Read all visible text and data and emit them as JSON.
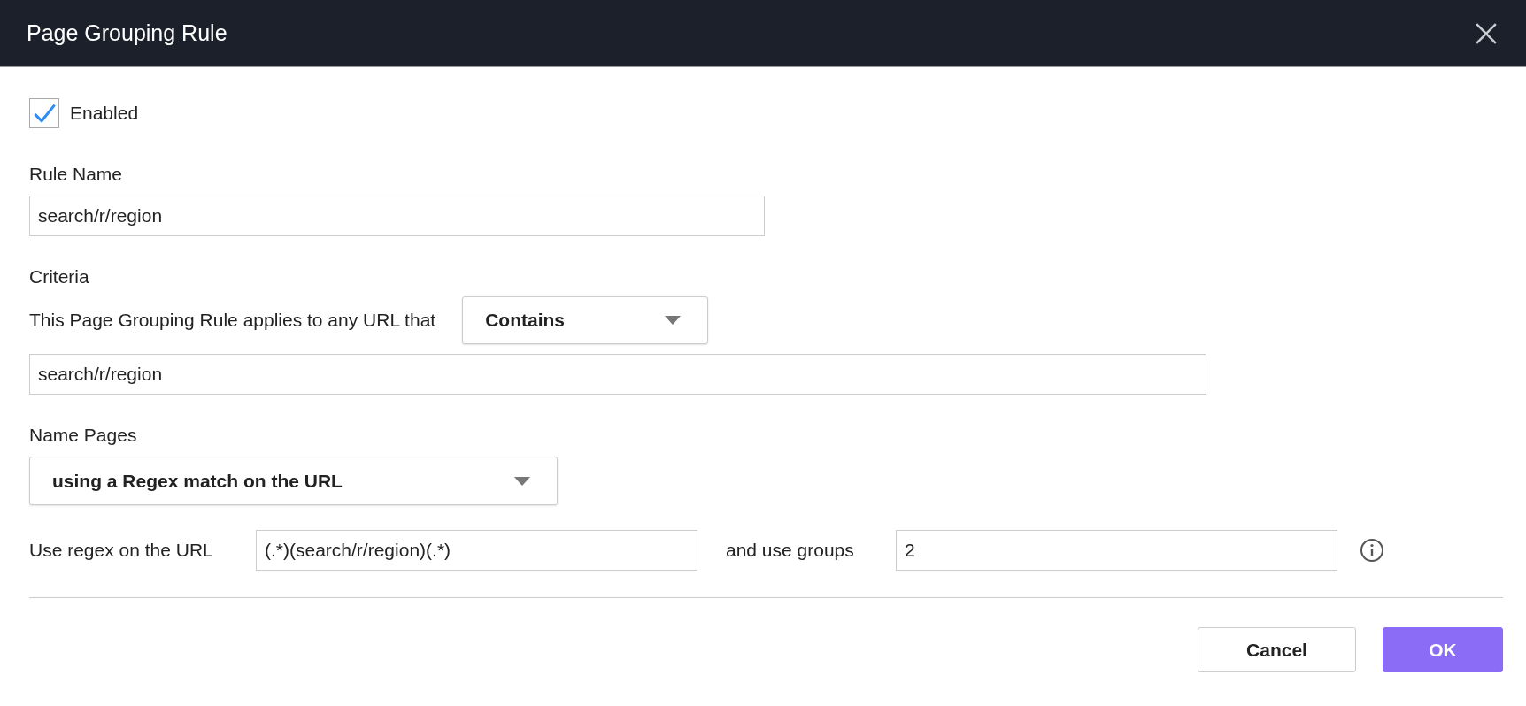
{
  "window": {
    "title": "Page Grouping Rule"
  },
  "enabled": {
    "label": "Enabled",
    "checked": true
  },
  "rule_name": {
    "label": "Rule Name",
    "value": "search/r/region"
  },
  "criteria": {
    "label": "Criteria",
    "sentence": "This Page Grouping Rule applies to any URL that",
    "match": "Contains",
    "value": "search/r/region"
  },
  "name_pages": {
    "label": "Name Pages",
    "method": "using a Regex match on the URL",
    "regex_label": "Use regex on the URL",
    "regex": "(.*)(search/r/region)(.*)",
    "groups_label": "and use groups",
    "groups": "2"
  },
  "buttons": [
    {
      "label": "Cancel",
      "kind": "secondary"
    },
    {
      "label": "OK",
      "kind": "primary"
    }
  ]
}
